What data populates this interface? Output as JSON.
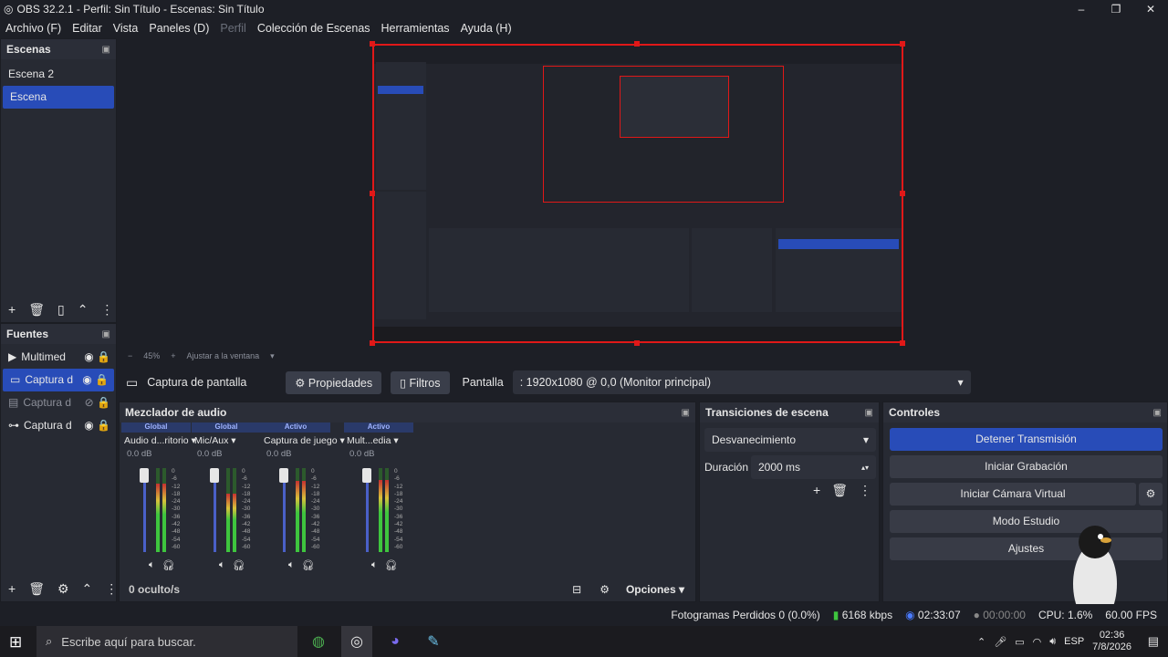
{
  "window": {
    "title": "OBS 32.2.1 - Perfil: Sin Título - Escenas: Sin Título",
    "minimize": "–",
    "maximize": "❐",
    "close": "✕"
  },
  "menu": [
    {
      "label": "Archivo (F)"
    },
    {
      "label": "Editar"
    },
    {
      "label": "Vista"
    },
    {
      "label": "Paneles (D)"
    },
    {
      "label": "Perfil",
      "disabled": true
    },
    {
      "label": "Colección de Escenas"
    },
    {
      "label": "Herramientas"
    },
    {
      "label": "Ayuda (H)"
    }
  ],
  "scenes": {
    "title": "Escenas",
    "items": [
      "Escena 2",
      "Escena"
    ],
    "selected": 1
  },
  "sources": {
    "title": "Fuentes",
    "items": [
      "Multimed",
      "Captura d",
      "Captura d",
      "Captura d"
    ],
    "selected": 1
  },
  "zoom": {
    "minus": "−",
    "value": "45%",
    "plus": "+",
    "fit": "Ajustar a la ventana"
  },
  "context": {
    "source": "Captura de pantalla",
    "properties": "Propiedades",
    "filters": "Filtros",
    "screen_label": "Pantalla",
    "screen_value": ": 1920x1080 @ 0,0 (Monitor principal)"
  },
  "mixer": {
    "title": "Mezclador de audio",
    "channels": [
      {
        "head": "Global",
        "name": "Audio d...ritorio",
        "db": "0.0 dB",
        "level": 0.82
      },
      {
        "head": "Global",
        "name": "Mic/Aux",
        "db": "0.0 dB",
        "level": 0.7
      },
      {
        "head": "Activo",
        "name": "Captura de juego",
        "db": "0.0 dB",
        "level": 0.85
      },
      {
        "head": "Activo",
        "name": "Mult...edia",
        "db": "0.0 dB",
        "level": 0.86
      }
    ],
    "scale": [
      "0",
      "-6",
      "-12",
      "-18",
      "-24",
      "-30",
      "-36",
      "-42",
      "-48",
      "-54",
      "-60"
    ],
    "hidden": "0 oculto/s",
    "options": "Opciones"
  },
  "transitions": {
    "title": "Transiciones de escena",
    "type": "Desvanecimiento",
    "duration_label": "Duración",
    "duration": "2000 ms"
  },
  "controls": {
    "title": "Controles",
    "stop_stream": "Detener Transmisión",
    "start_record": "Iniciar Grabación",
    "virtual_cam": "Iniciar Cámara Virtual",
    "studio": "Modo Estudio",
    "settings": "Ajustes"
  },
  "status": {
    "dropped": "Fotogramas Perdidos 0 (0.0%)",
    "bitrate": "6168 kbps",
    "live_time": "02:33:07",
    "rec_time": "00:00:00",
    "cpu": "CPU: 1.6%",
    "fps": "60.00 FPS"
  },
  "taskbar": {
    "search": "Escribe aquí para buscar.",
    "lang": "ESP",
    "time": "02:36",
    "date": "7/8/2026"
  },
  "colors": {
    "accent": "#284cb8",
    "selection": "#e01818",
    "bg": "#1d1f26"
  }
}
